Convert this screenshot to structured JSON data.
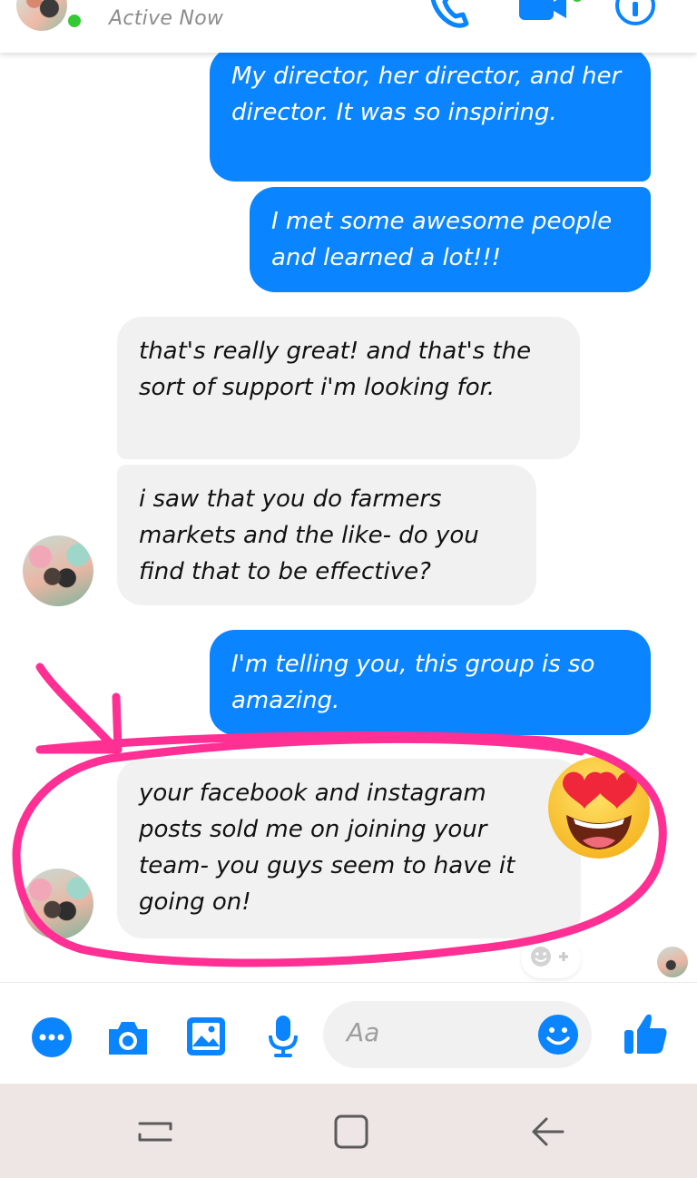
{
  "header": {
    "status": "Active Now"
  },
  "messages": [
    {
      "side": "out",
      "text": "My director,  her director, and her director.  It was so inspiring."
    },
    {
      "side": "out",
      "text": "I met some awesome people and learned a lot!!!"
    },
    {
      "side": "in",
      "text": "that's really great! and that's the sort of support i'm looking for."
    },
    {
      "side": "in",
      "text": "i saw that you do farmers markets and the like- do you find that to be effective?"
    },
    {
      "side": "out",
      "text": "I'm telling you, this group is so amazing."
    },
    {
      "side": "in",
      "text": "your facebook and instagram posts sold me on joining your team- you guys seem to have it going on!"
    }
  ],
  "composer": {
    "placeholder": "Aa"
  },
  "icons": {
    "header": [
      "phone-icon",
      "video-call-icon",
      "info-icon"
    ],
    "composer": [
      "more-icon",
      "camera-icon",
      "gallery-icon",
      "microphone-icon",
      "emoji-icon",
      "thumbs-up-icon"
    ],
    "nav": [
      "recent-apps-icon",
      "home-icon",
      "back-icon"
    ]
  },
  "colors": {
    "accent": "#0a84ff",
    "incoming_bubble": "#f1f1f1",
    "annotation": "#ff2f93",
    "active": "#35c934"
  }
}
